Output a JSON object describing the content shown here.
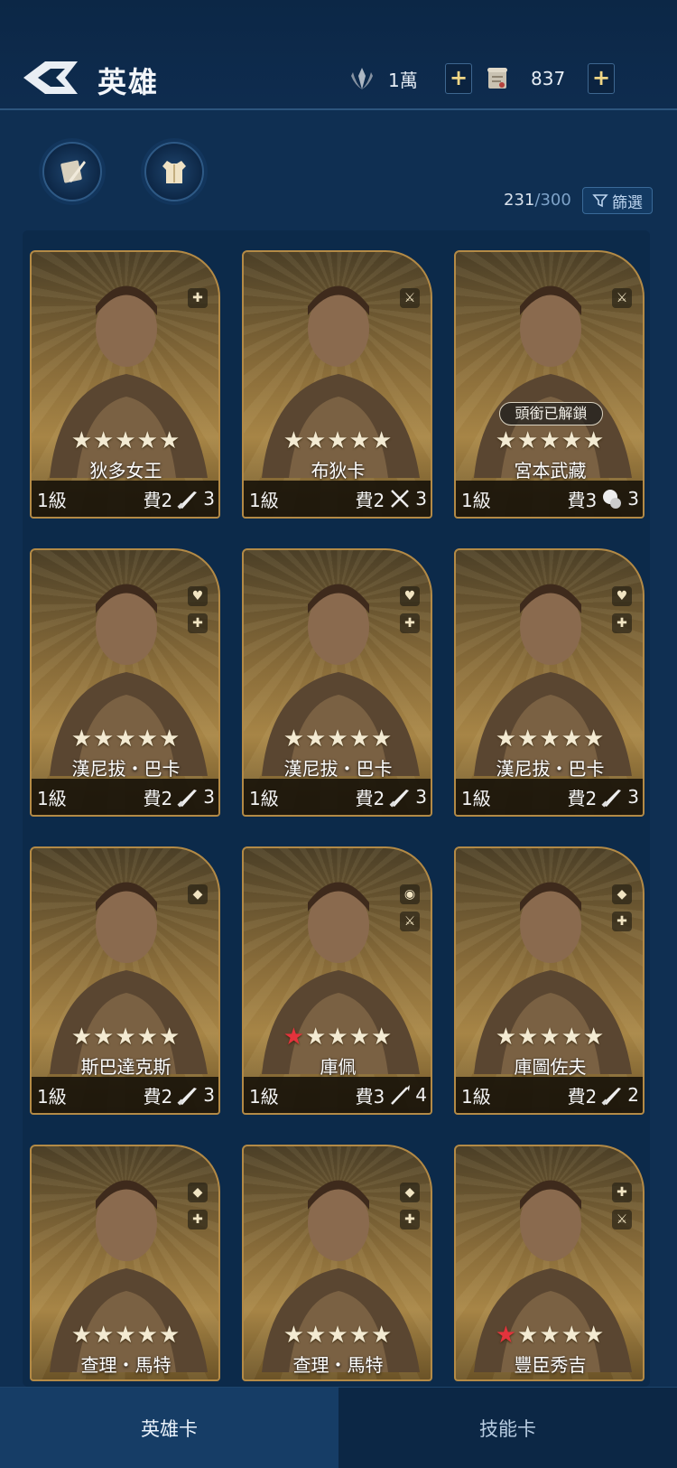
{
  "header": {
    "title": "英雄",
    "resources": [
      {
        "icon": "laurel-emblem-icon",
        "value": "1萬"
      },
      {
        "icon": "scroll-icon",
        "value": "837"
      }
    ],
    "plus_label": "+"
  },
  "toolbar": {
    "count_current": "231",
    "count_sep": "/",
    "count_max": "300",
    "filter_label": "篩選"
  },
  "cards": [
    {
      "name": "狄多女王",
      "stars": "★★★★★",
      "level": "1級",
      "cost": "費2",
      "weapon": "rifle-icon",
      "weapon_count": "3",
      "roles": [
        "shield-plus-icon"
      ]
    },
    {
      "name": "布狄卡",
      "stars": "★★★★★",
      "level": "1級",
      "cost": "費2",
      "weapon": "crossed-swords-icon",
      "weapon_count": "3",
      "roles": [
        "sword-icon"
      ]
    },
    {
      "name": "宮本武藏",
      "stars": "★★★★★",
      "level": "1級",
      "cost": "費3",
      "weapon": "fist-icon",
      "weapon_count": "3",
      "roles": [
        "sword-icon"
      ],
      "tag": "頭銜已解鎖"
    },
    {
      "name": "漢尼拔・巴卡",
      "stars": "★★★★★",
      "level": "1級",
      "cost": "費2",
      "weapon": "rifle-icon",
      "weapon_count": "3",
      "roles": [
        "heart-plus-icon",
        "shield-plus-icon"
      ]
    },
    {
      "name": "漢尼拔・巴卡",
      "stars": "★★★★★",
      "level": "1級",
      "cost": "費2",
      "weapon": "rifle-icon",
      "weapon_count": "3",
      "roles": [
        "heart-plus-icon",
        "shield-plus-icon"
      ]
    },
    {
      "name": "漢尼拔・巴卡",
      "stars": "★★★★★",
      "level": "1級",
      "cost": "費2",
      "weapon": "rifle-icon",
      "weapon_count": "3",
      "roles": [
        "heart-plus-icon",
        "shield-plus-icon"
      ]
    },
    {
      "name": "斯巴達克斯",
      "stars": "★★★★★",
      "level": "1級",
      "cost": "費2",
      "weapon": "rifle-icon",
      "weapon_count": "3",
      "roles": [
        "shield-icon"
      ]
    },
    {
      "name": "庫佩",
      "stars": "★★★★★",
      "red_stars": 1,
      "level": "1級",
      "cost": "費3",
      "weapon": "spear-icon",
      "weapon_count": "4",
      "roles": [
        "eye-icon",
        "sword-icon"
      ]
    },
    {
      "name": "庫圖佐夫",
      "stars": "★★★★★",
      "level": "1級",
      "cost": "費2",
      "weapon": "rifle-icon",
      "weapon_count": "2",
      "roles": [
        "shield-icon",
        "shield-plus-icon"
      ]
    },
    {
      "name": "查理・馬特",
      "stars": "★★★★★",
      "roles": [
        "shield-icon",
        "shield-plus-icon"
      ]
    },
    {
      "name": "查理・馬特",
      "stars": "★★★★★",
      "roles": [
        "shield-icon",
        "shield-plus-icon"
      ]
    },
    {
      "name": "豐臣秀吉",
      "stars": "★★★★★",
      "red_stars": 1,
      "roles": [
        "shield-plus-icon",
        "sword-icon"
      ]
    }
  ],
  "tabs": [
    {
      "label": "英雄卡",
      "active": true
    },
    {
      "label": "技能卡",
      "active": false
    }
  ],
  "colors": {
    "background": "#0f2f52",
    "card_border": "#b38a46",
    "red_star": "#e3333c",
    "accent_gold": "#f0d685"
  }
}
